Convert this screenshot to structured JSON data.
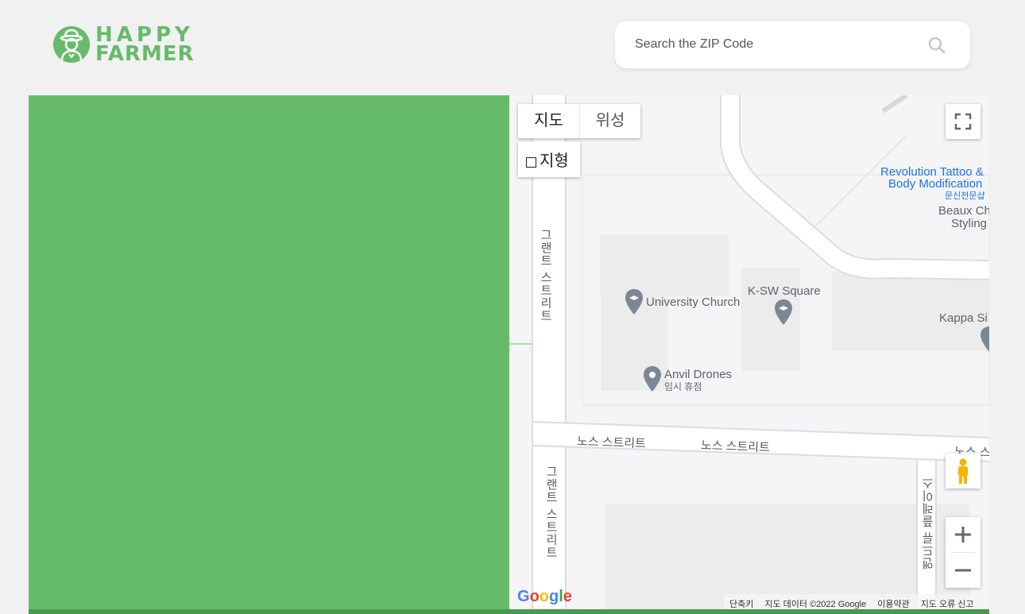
{
  "brand": {
    "line1": "HAPPY",
    "line2": "FARMER",
    "accent": "#66bb6a"
  },
  "search": {
    "placeholder": "Search the ZIP Code",
    "value": ""
  },
  "map": {
    "type_controls": {
      "map": "지도",
      "satellite": "위성",
      "terrain": "지형"
    },
    "labels": {
      "university_church": "University Church",
      "ksw_square": "K-SW Square",
      "anvil_drones": "Anvil Drones",
      "anvil_drones_sub": "임시 휴점",
      "revolution_1": "Revolution Tattoo &",
      "revolution_2": "Body Modification",
      "revolution_3": "문신전문샵",
      "beaux_1": "Beaux Ch",
      "beaux_2": "Styling",
      "kappa": "Kappa Si"
    },
    "roads": {
      "grand_top": "그랜트 스트리트",
      "grand_bottom": "그랜트 스트리트",
      "north_1": "노스 스트리트",
      "north_2": "노스 스트리트",
      "north_3": "노스 스",
      "andrew": "앤드류 플레이스"
    },
    "google_logo": "Google",
    "footer": {
      "shortcuts": "단축키",
      "data": "지도 데이터 ©2022 Google",
      "terms": "이용약관",
      "report": "지도 오류 신고"
    },
    "colors": {
      "panel": "#66bb6a",
      "bar": "#4a9a4e",
      "business": "#1a73e8"
    }
  }
}
